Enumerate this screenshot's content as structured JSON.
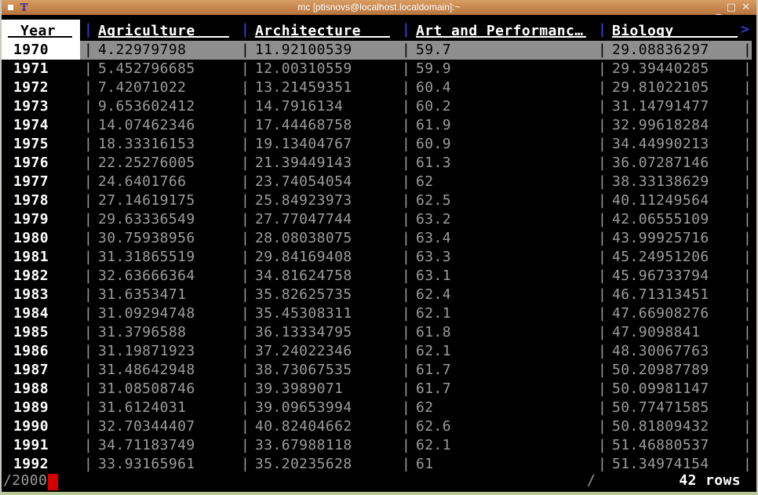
{
  "titlebar": {
    "title": "mc [ptisnovs@localhost.localdomain]:~",
    "minimize_label": "_",
    "maximize_label": "□",
    "close_label": "✕"
  },
  "table": {
    "columns": [
      "Year",
      "Agriculture",
      "Architecture",
      "Art and Performanc…",
      "Biology"
    ],
    "separator": "|",
    "more_columns_indicator": ">",
    "cursor_row_index": 0,
    "rows": [
      [
        "1970",
        "4.22979798",
        "11.92100539",
        "59.7",
        "29.08836297"
      ],
      [
        "1971",
        "5.452796685",
        "12.00310559",
        "59.9",
        "29.39440285"
      ],
      [
        "1972",
        "7.42071022",
        "13.21459351",
        "60.4",
        "29.81022105"
      ],
      [
        "1973",
        "9.653602412",
        "14.7916134",
        "60.2",
        "31.14791477"
      ],
      [
        "1974",
        "14.07462346",
        "17.44468758",
        "61.9",
        "32.99618284"
      ],
      [
        "1975",
        "18.33316153",
        "19.13404767",
        "60.9",
        "34.44990213"
      ],
      [
        "1976",
        "22.25276005",
        "21.39449143",
        "61.3",
        "36.07287146"
      ],
      [
        "1977",
        "24.6401766",
        "23.74054054",
        "62",
        "38.33138629"
      ],
      [
        "1978",
        "27.14619175",
        "25.84923973",
        "62.5",
        "40.11249564"
      ],
      [
        "1979",
        "29.63336549",
        "27.77047744",
        "63.2",
        "42.06555109"
      ],
      [
        "1980",
        "30.75938956",
        "28.08038075",
        "63.4",
        "43.99925716"
      ],
      [
        "1981",
        "31.31865519",
        "29.84169408",
        "63.3",
        "45.24951206"
      ],
      [
        "1982",
        "32.63666364",
        "34.81624758",
        "63.1",
        "45.96733794"
      ],
      [
        "1983",
        "31.6353471",
        "35.82625735",
        "62.4",
        "46.71313451"
      ],
      [
        "1984",
        "31.09294748",
        "35.45308311",
        "62.1",
        "47.66908276"
      ],
      [
        "1985",
        "31.3796588",
        "36.13334795",
        "61.8",
        "47.9098841"
      ],
      [
        "1986",
        "31.19871923",
        "37.24022346",
        "62.1",
        "48.30067763"
      ],
      [
        "1987",
        "31.48642948",
        "38.73067535",
        "61.7",
        "50.20987789"
      ],
      [
        "1988",
        "31.08508746",
        "39.3989071",
        "61.7",
        "50.09981147"
      ],
      [
        "1989",
        "31.6124031",
        "39.09653994",
        "62",
        "50.77471585"
      ],
      [
        "1990",
        "32.70344407",
        "40.82404662",
        "62.6",
        "50.81809432"
      ],
      [
        "1991",
        "34.71183749",
        "33.67988118",
        "62.1",
        "51.46880537"
      ],
      [
        "1992",
        "33.93165961",
        "35.20235628",
        "61",
        "51.34974154"
      ]
    ]
  },
  "status": {
    "input": "/2000",
    "middle": "/",
    "row_count": "42 rows"
  },
  "colors": {
    "accent_blue": "#2b3ccc",
    "cursor_red": "#d40000",
    "row_highlight_gray": "#8e8e8e",
    "value_gray": "#9c9c9c",
    "titlebar_tan": "#c98a52"
  }
}
